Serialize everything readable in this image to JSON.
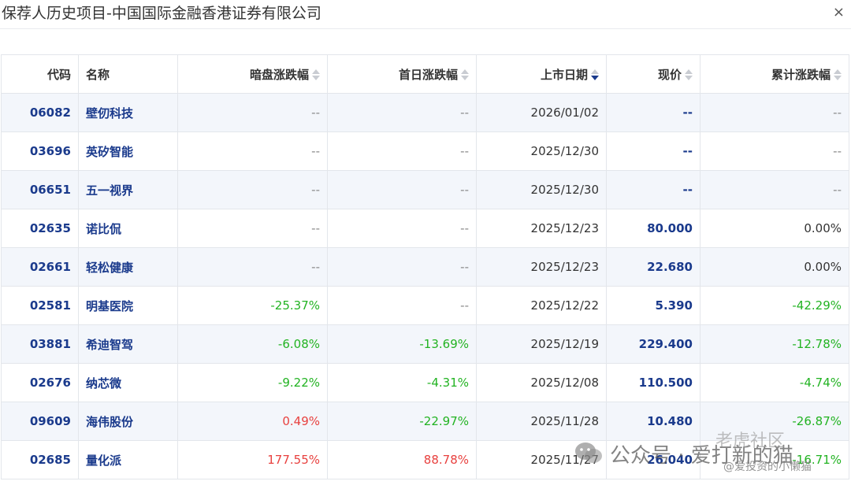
{
  "dialog": {
    "title": "保荐人历史项目-中国国际金融香港证券有限公司",
    "close_symbol": "×"
  },
  "table": {
    "columns": [
      "代码",
      "名称",
      "暗盘涨跌幅",
      "首日涨跌幅",
      "上市日期",
      "现价",
      "累计涨跌幅"
    ],
    "rows": [
      {
        "code": "06082",
        "name": "壁仞科技",
        "dark": "--",
        "first": "--",
        "date": "2026/01/02",
        "price": "--",
        "cum": "--"
      },
      {
        "code": "03696",
        "name": "英矽智能",
        "dark": "--",
        "first": "--",
        "date": "2025/12/30",
        "price": "--",
        "cum": "--"
      },
      {
        "code": "06651",
        "name": "五一视界",
        "dark": "--",
        "first": "--",
        "date": "2025/12/30",
        "price": "--",
        "cum": "--"
      },
      {
        "code": "02635",
        "name": "诺比侃",
        "dark": "--",
        "first": "--",
        "date": "2025/12/23",
        "price": "80.000",
        "cum": "0.00%"
      },
      {
        "code": "02661",
        "name": "轻松健康",
        "dark": "--",
        "first": "--",
        "date": "2025/12/23",
        "price": "22.680",
        "cum": "0.00%"
      },
      {
        "code": "02581",
        "name": "明基医院",
        "dark": "-25.37%",
        "first": "--",
        "date": "2025/12/22",
        "price": "5.390",
        "cum": "-42.29%"
      },
      {
        "code": "03881",
        "name": "希迪智驾",
        "dark": "-6.08%",
        "first": "-13.69%",
        "date": "2025/12/19",
        "price": "229.400",
        "cum": "-12.78%"
      },
      {
        "code": "02676",
        "name": "纳芯微",
        "dark": "-9.22%",
        "first": "-4.31%",
        "date": "2025/12/08",
        "price": "110.500",
        "cum": "-4.74%"
      },
      {
        "code": "09609",
        "name": "海伟股份",
        "dark": "0.49%",
        "first": "-22.97%",
        "date": "2025/11/28",
        "price": "10.480",
        "cum": "-26.87%"
      },
      {
        "code": "02685",
        "name": "量化派",
        "dark": "177.55%",
        "first": "88.78%",
        "date": "2025/11/27",
        "price": "26.040",
        "cum": "-16.71%"
      }
    ]
  },
  "watermark": {
    "main": "公众号 · 爱打新的猫",
    "right": "老虎社区",
    "sub": "@爱投资的小懒猫"
  },
  "colors": {
    "up": "#e8413f",
    "down": "#22b322",
    "link": "#1a3a8c",
    "stripe": "#f3f6fb"
  }
}
